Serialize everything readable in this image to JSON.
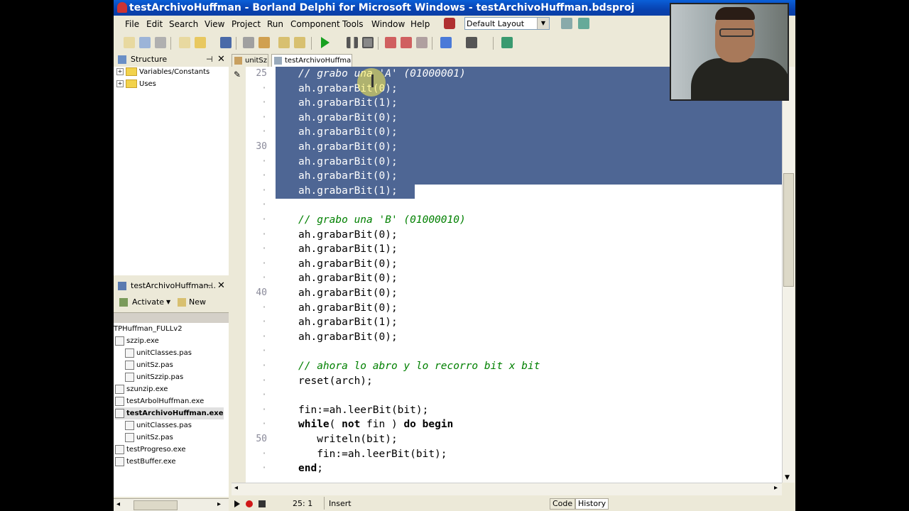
{
  "window": {
    "title": "testArchivoHuffman - Borland Delphi for Microsoft Windows - testArchivoHuffman.bdsproj"
  },
  "menu": [
    "File",
    "Edit",
    "Search",
    "View",
    "Project",
    "Run",
    "Component",
    "Tools",
    "Window",
    "Help"
  ],
  "layout_select": {
    "value": "Default Layout"
  },
  "structure": {
    "title": "Structure",
    "items": [
      "Variables/Constants",
      "Uses"
    ]
  },
  "project_manager": {
    "title": "testArchivoHuffman...",
    "activate_label": "Activate",
    "new_label": "New",
    "files": [
      {
        "name": "TPHuffman_FULLv2",
        "level": 0
      },
      {
        "name": "szzip.exe",
        "level": 1
      },
      {
        "name": "unitClasses.pas",
        "level": 2
      },
      {
        "name": "unitSz.pas",
        "level": 2
      },
      {
        "name": "unitSzzip.pas",
        "level": 2
      },
      {
        "name": "szunzip.exe",
        "level": 1
      },
      {
        "name": "testArbolHuffman.exe",
        "level": 1
      },
      {
        "name": "testArchivoHuffman.exe",
        "level": 1,
        "selected": true
      },
      {
        "name": "unitClasses.pas",
        "level": 2
      },
      {
        "name": "unitSz.pas",
        "level": 2
      },
      {
        "name": "testProgreso.exe",
        "level": 1
      },
      {
        "name": "testBuffer.exe",
        "level": 1
      }
    ]
  },
  "editor": {
    "tabs": [
      "unitSz",
      "testArchivoHuffman"
    ],
    "lines": [
      {
        "num": "25",
        "text": "// grabo una 'A' (01000001)",
        "type": "comment",
        "selected": true
      },
      {
        "num": "",
        "text": "ah.grabarBit(0);",
        "type": "code",
        "selected": true
      },
      {
        "num": "",
        "text": "ah.grabarBit(1);",
        "type": "code",
        "selected": true
      },
      {
        "num": "",
        "text": "ah.grabarBit(0);",
        "type": "code",
        "selected": true
      },
      {
        "num": "",
        "text": "ah.grabarBit(0);",
        "type": "code",
        "selected": true
      },
      {
        "num": "30",
        "text": "ah.grabarBit(0);",
        "type": "code",
        "selected": true
      },
      {
        "num": "",
        "text": "ah.grabarBit(0);",
        "type": "code",
        "selected": true
      },
      {
        "num": "",
        "text": "ah.grabarBit(0);",
        "type": "code",
        "selected": true
      },
      {
        "num": "",
        "text": "ah.grabarBit(1);",
        "type": "code",
        "selected": true
      },
      {
        "num": "",
        "text": "",
        "type": "code",
        "selected": false
      },
      {
        "num": "",
        "text": "// grabo una 'B' (01000010)",
        "type": "comment",
        "selected": false
      },
      {
        "num": "",
        "text": "ah.grabarBit(0);",
        "type": "code",
        "selected": false
      },
      {
        "num": "",
        "text": "ah.grabarBit(1);",
        "type": "code",
        "selected": false
      },
      {
        "num": "",
        "text": "ah.grabarBit(0);",
        "type": "code",
        "selected": false
      },
      {
        "num": "",
        "text": "ah.grabarBit(0);",
        "type": "code",
        "selected": false
      },
      {
        "num": "40",
        "text": "ah.grabarBit(0);",
        "type": "code",
        "selected": false
      },
      {
        "num": "",
        "text": "ah.grabarBit(0);",
        "type": "code",
        "selected": false
      },
      {
        "num": "",
        "text": "ah.grabarBit(1);",
        "type": "code",
        "selected": false
      },
      {
        "num": "",
        "text": "ah.grabarBit(0);",
        "type": "code",
        "selected": false
      },
      {
        "num": "",
        "text": "",
        "type": "code",
        "selected": false
      },
      {
        "num": "",
        "text": "// ahora lo abro y lo recorro bit x bit",
        "type": "comment",
        "selected": false
      },
      {
        "num": "",
        "text": "reset(arch);",
        "type": "code",
        "selected": false
      },
      {
        "num": "",
        "text": "",
        "type": "code",
        "selected": false
      },
      {
        "num": "",
        "text": "fin:=ah.leerBit(bit);",
        "type": "code",
        "selected": false
      },
      {
        "num": "",
        "text": "while( not fin ) do begin",
        "type": "kwline",
        "selected": false
      },
      {
        "num": "50",
        "text": "   writeln(bit);",
        "type": "code",
        "selected": false
      },
      {
        "num": "",
        "text": "   fin:=ah.leerBit(bit);",
        "type": "code",
        "selected": false
      },
      {
        "num": "",
        "text": "end;",
        "type": "kwend",
        "selected": false
      }
    ]
  },
  "status": {
    "position": "25:  1",
    "mode": "Insert",
    "tab_code": "Code",
    "tab_history": "History"
  }
}
